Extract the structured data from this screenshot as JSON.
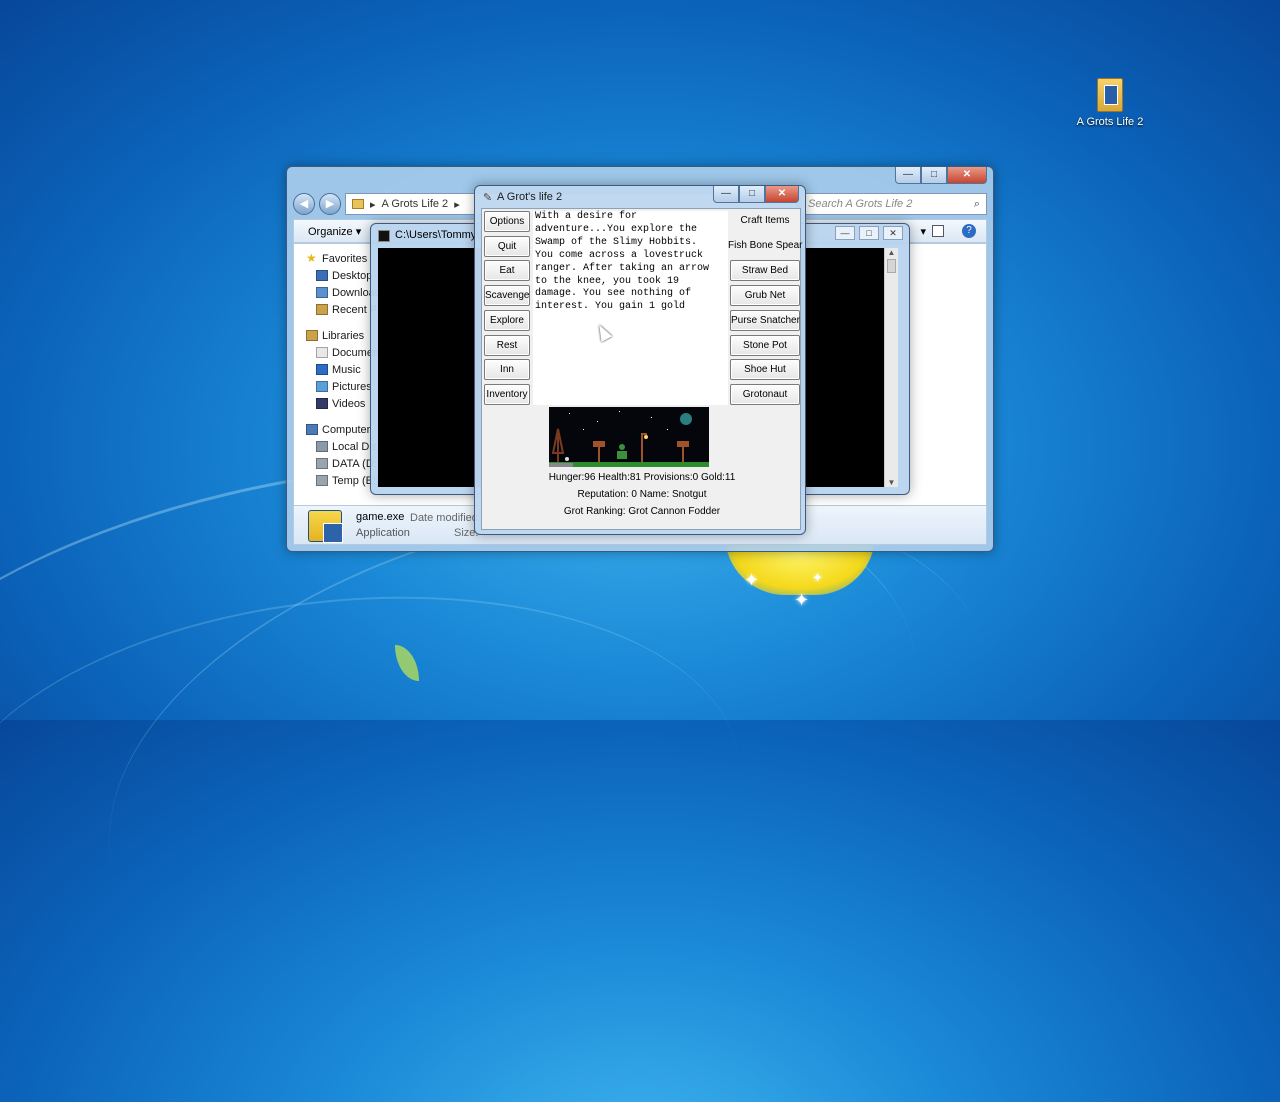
{
  "desktop": {
    "icon_label": "A Grots Life 2"
  },
  "explorer": {
    "address": "A Grots Life 2",
    "search_placeholder": "Search A Grots Life 2",
    "organize_label": "Organize",
    "nav": [
      {
        "label": "Favorites",
        "icon": "star-icon",
        "head": true
      },
      {
        "label": "Desktop",
        "icon": "desktop-icon"
      },
      {
        "label": "Downloads",
        "icon": "downloads-icon"
      },
      {
        "label": "Recent Places",
        "icon": "recent-places-icon"
      },
      {
        "gap": true
      },
      {
        "label": "Libraries",
        "icon": "libraries-icon",
        "head": true
      },
      {
        "label": "Documents",
        "icon": "documents-icon"
      },
      {
        "label": "Music",
        "icon": "music-icon"
      },
      {
        "label": "Pictures",
        "icon": "pictures-icon"
      },
      {
        "label": "Videos",
        "icon": "videos-icon"
      },
      {
        "gap": true
      },
      {
        "label": "Computer",
        "icon": "computer-icon",
        "head": true
      },
      {
        "label": "Local Disk",
        "icon": "local-disk-icon"
      },
      {
        "label": "DATA (D:)",
        "icon": "drive-icon"
      },
      {
        "label": "Temp (E:)",
        "icon": "drive-icon"
      }
    ],
    "details": {
      "file_name": "game.exe",
      "file_type": "Application",
      "date_modified_label": "Date modified:",
      "size_label": "Size:"
    }
  },
  "console": {
    "title": "C:\\Users\\Tommy\\D"
  },
  "game": {
    "title": "A Grot's life 2",
    "left_buttons": [
      "Options",
      "Quit",
      "Eat",
      "Scavenge",
      "Explore",
      "Rest",
      "Inn",
      "Inventory"
    ],
    "right_buttons": [
      "Craft Items",
      "Fish Bone Spear",
      "Straw Bed",
      "Grub Net",
      "Purse Snatcher",
      "Stone Pot",
      "Shoe Hut",
      "Grotonaut"
    ],
    "story_text": "With a desire for\nadventure...You explore the\nSwamp of the Slimy Hobbits.\nYou come across a lovestruck\nranger. After taking an arrow\nto the knee, you took 19\ndamage. You see nothing of\ninterest. You gain 1 gold",
    "stats_line": "Hunger:96 Health:81 Provisions:0 Gold:11",
    "reputation_line": "Reputation: 0  Name: Snotgut",
    "ranking_line": "Grot Ranking: Grot Cannon Fodder"
  },
  "colors": {
    "desktop_blue": "#1b8ad8",
    "console_black": "#000000",
    "close_red": "#c6452f"
  }
}
